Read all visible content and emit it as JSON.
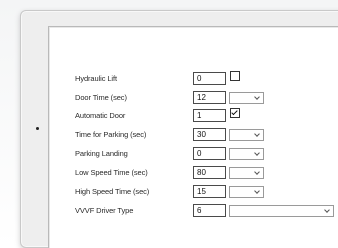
{
  "form": {
    "rows": [
      {
        "label": "Hydraulic Lift",
        "value": "0",
        "control": "checkbox",
        "checked": false
      },
      {
        "label": "Door Time (sec)",
        "value": "12",
        "control": "dropdown"
      },
      {
        "label": "Automatic Door",
        "value": "1",
        "control": "checkbox",
        "checked": true
      },
      {
        "label": "Time for Parking (sec)",
        "value": "30",
        "control": "dropdown"
      },
      {
        "label": "Parking Landing",
        "value": "0",
        "control": "dropdown"
      },
      {
        "label": "Low Speed Time (sec)",
        "value": "80",
        "control": "dropdown"
      },
      {
        "label": "High Speed Time (sec)",
        "value": "15",
        "control": "dropdown"
      },
      {
        "label": "VVVF Driver Type",
        "value": "6",
        "control": "dropdown-wide"
      }
    ]
  },
  "icons": {
    "dropdown_arrow": "chevron-down-icon",
    "checkbox_mark": "checkmark-icon"
  }
}
